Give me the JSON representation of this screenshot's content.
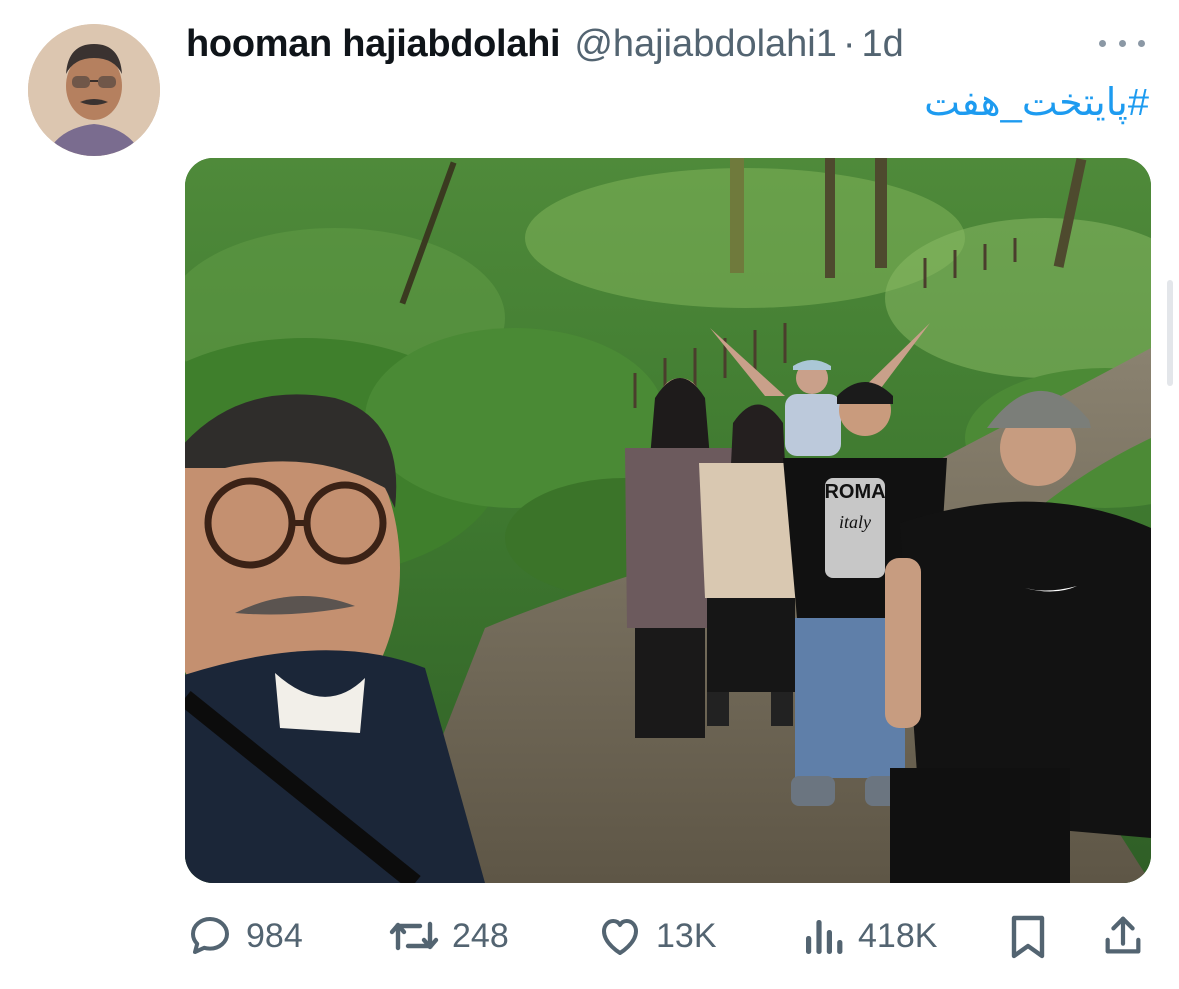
{
  "tweet": {
    "author": {
      "display_name": "hooman hajiabdolahi",
      "handle": "@hajiabdolahi1",
      "separator": "·",
      "time": "1d"
    },
    "text": "#پایتخت_هفت",
    "media": {
      "logo_text": "ROMA",
      "logo_sub": "italy"
    },
    "stats": {
      "replies": "984",
      "retweets": "248",
      "likes": "13K",
      "views": "418K"
    }
  },
  "icons": {
    "more": "more-icon",
    "reply": "reply-icon",
    "retweet": "retweet-icon",
    "like": "heart-icon",
    "views": "views-icon",
    "bookmark": "bookmark-icon",
    "share": "share-icon"
  },
  "colors": {
    "text": "#0f1419",
    "secondary": "#536471",
    "link": "#1d9bf0"
  }
}
